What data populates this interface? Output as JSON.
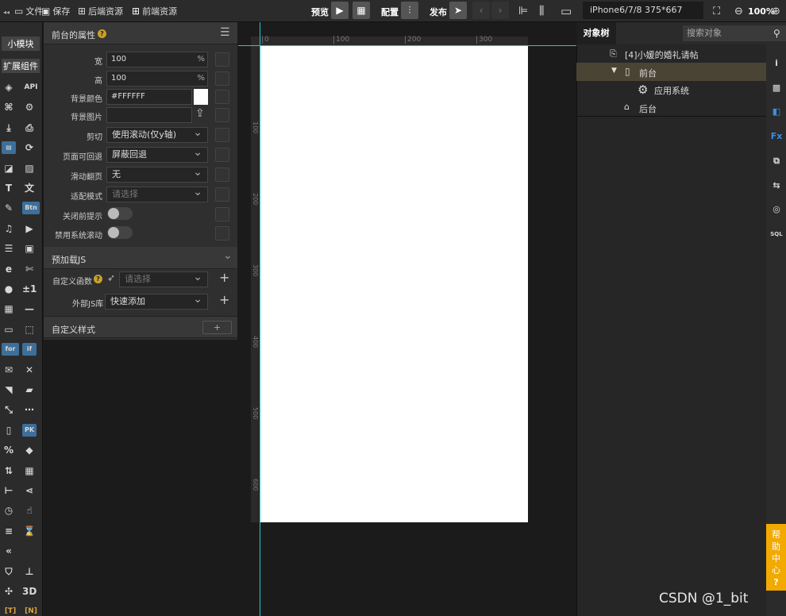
{
  "topbar": {
    "file": "文件",
    "save": "保存",
    "backend": "后端资源",
    "frontend": "前端资源",
    "preview": "预览",
    "config": "配置",
    "publish": "发布",
    "device": "iPhone6/7/8 375*667",
    "zoom": "100%"
  },
  "left_tabs": {
    "small_block": "小模块",
    "extend": "扩展组件"
  },
  "components": [
    {
      "icon": "cube-icon",
      "glyph": "◈"
    },
    {
      "icon": "api-icon",
      "glyph": "API"
    },
    {
      "icon": "puzzle-icon",
      "glyph": "⌘"
    },
    {
      "icon": "gear-icon",
      "glyph": "⚙"
    },
    {
      "icon": "download-icon",
      "glyph": "⤓"
    },
    {
      "icon": "upload-icon",
      "glyph": "⎙"
    },
    {
      "icon": "form-icon",
      "glyph": "▤"
    },
    {
      "icon": "rotate-device-icon",
      "glyph": "⟳"
    },
    {
      "icon": "chart-icon",
      "glyph": "◪"
    },
    {
      "icon": "image-icon",
      "glyph": "▨"
    },
    {
      "icon": "text-icon",
      "glyph": "T"
    },
    {
      "icon": "translate-icon",
      "glyph": "文"
    },
    {
      "icon": "edit-icon",
      "glyph": "✎"
    },
    {
      "icon": "btn-icon",
      "glyph": "Btn"
    },
    {
      "icon": "music-icon",
      "glyph": "♫"
    },
    {
      "icon": "video-icon",
      "glyph": "▶"
    },
    {
      "icon": "list-icon",
      "glyph": "☰"
    },
    {
      "icon": "window-icon",
      "glyph": "▣"
    },
    {
      "icon": "ie-icon",
      "glyph": "e"
    },
    {
      "icon": "tools-icon",
      "glyph": "✄"
    },
    {
      "icon": "counter-icon",
      "glyph": "●"
    },
    {
      "icon": "plus-minus-icon",
      "glyph": "±1"
    },
    {
      "icon": "qrcode-icon",
      "glyph": "▦"
    },
    {
      "icon": "divider-icon",
      "glyph": "—"
    },
    {
      "icon": "live-icon",
      "glyph": "▭"
    },
    {
      "icon": "click-icon",
      "glyph": "⬚"
    },
    {
      "icon": "for-icon",
      "glyph": "for"
    },
    {
      "icon": "if-icon",
      "glyph": "if"
    },
    {
      "icon": "note-icon",
      "glyph": "✉"
    },
    {
      "icon": "close-box-icon",
      "glyph": "✕"
    },
    {
      "icon": "bookmark-icon",
      "glyph": "◥"
    },
    {
      "icon": "folder-icon",
      "glyph": "▰"
    },
    {
      "icon": "resize-icon",
      "glyph": "⤡"
    },
    {
      "icon": "dots-icon",
      "glyph": "⋯"
    },
    {
      "icon": "phone-icon",
      "glyph": "▯"
    },
    {
      "icon": "pk-icon",
      "glyph": "PK"
    },
    {
      "icon": "percent-icon",
      "glyph": "%"
    },
    {
      "icon": "layers-icon",
      "glyph": "◆"
    },
    {
      "icon": "sort-icon",
      "glyph": "⇅"
    },
    {
      "icon": "table-icon",
      "glyph": "▦"
    },
    {
      "icon": "tree-icon",
      "glyph": "⊢"
    },
    {
      "icon": "share-icon",
      "glyph": "⋖"
    },
    {
      "icon": "timer-icon",
      "glyph": "◷"
    },
    {
      "icon": "touch-icon",
      "glyph": "☝"
    },
    {
      "icon": "sliders-icon",
      "glyph": "≡"
    },
    {
      "icon": "hourglass-icon",
      "glyph": "⌛"
    },
    {
      "icon": "chevrons-icon",
      "glyph": "«"
    },
    {
      "icon": "blank-icon",
      "glyph": ""
    },
    {
      "icon": "billboard-icon",
      "glyph": "⛉"
    },
    {
      "icon": "org-icon",
      "glyph": "⊥"
    },
    {
      "icon": "gyro-icon",
      "glyph": "✣"
    },
    {
      "icon": "3d-icon",
      "glyph": "3D"
    },
    {
      "icon": "t-bracket-icon",
      "glyph": "[T]"
    },
    {
      "icon": "n-bracket-icon",
      "glyph": "[N]"
    }
  ],
  "props": {
    "title": "前台的属性",
    "width_label": "宽",
    "width_value": "100",
    "unit": "%",
    "height_label": "高",
    "height_value": "100",
    "bgcolor_label": "背景颜色",
    "bgcolor_value": "#FFFFFF",
    "bgimg_label": "背景图片",
    "clip_label": "剪切",
    "clip_value": "使用滚动(仅y轴)",
    "back_label": "页面可回退",
    "back_value": "屏蔽回退",
    "swipe_label": "滑动翻页",
    "swipe_value": "无",
    "fit_label": "适配模式",
    "fit_placeholder": "请选择",
    "close_tip_label": "关闭前提示",
    "disable_scroll_label": "禁用系统滚动"
  },
  "preload": {
    "title": "预加载JS",
    "custom_fn_label": "自定义函数",
    "custom_fn_placeholder": "请选择",
    "ext_lib_label": "外部JS库",
    "ext_lib_value": "快速添加"
  },
  "custom_style": {
    "title": "自定义样式",
    "add": "+"
  },
  "ruler": {
    "top": [
      "0",
      "100",
      "200",
      "300"
    ],
    "left": [
      "100",
      "200",
      "300",
      "400",
      "500",
      "600"
    ]
  },
  "tree": {
    "tab": "对象树",
    "search_placeholder": "搜索对象",
    "root": "[4]小媛的婚礼请帖",
    "front": "前台",
    "app_system": "应用系统",
    "back": "后台"
  },
  "right_icons": [
    {
      "icon": "info-icon",
      "glyph": "i"
    },
    {
      "icon": "badge-icon",
      "glyph": "▩"
    },
    {
      "icon": "chat-icon",
      "glyph": "◧"
    },
    {
      "icon": "fx-icon",
      "glyph": "Fx"
    },
    {
      "icon": "copy-icon",
      "glyph": "⧉"
    },
    {
      "icon": "swap-icon",
      "glyph": "⇆"
    },
    {
      "icon": "target-icon",
      "glyph": "◎"
    },
    {
      "icon": "sql-icon",
      "glyph": "SQL"
    }
  ],
  "help": {
    "l1": "帮",
    "l2": "助",
    "l3": "中",
    "l4": "心",
    "q": "?"
  },
  "watermark": "CSDN @1_bit",
  "colors": {
    "accent": "#25c6d6",
    "help": "#f2a900",
    "selected_row": "#4a4434"
  }
}
